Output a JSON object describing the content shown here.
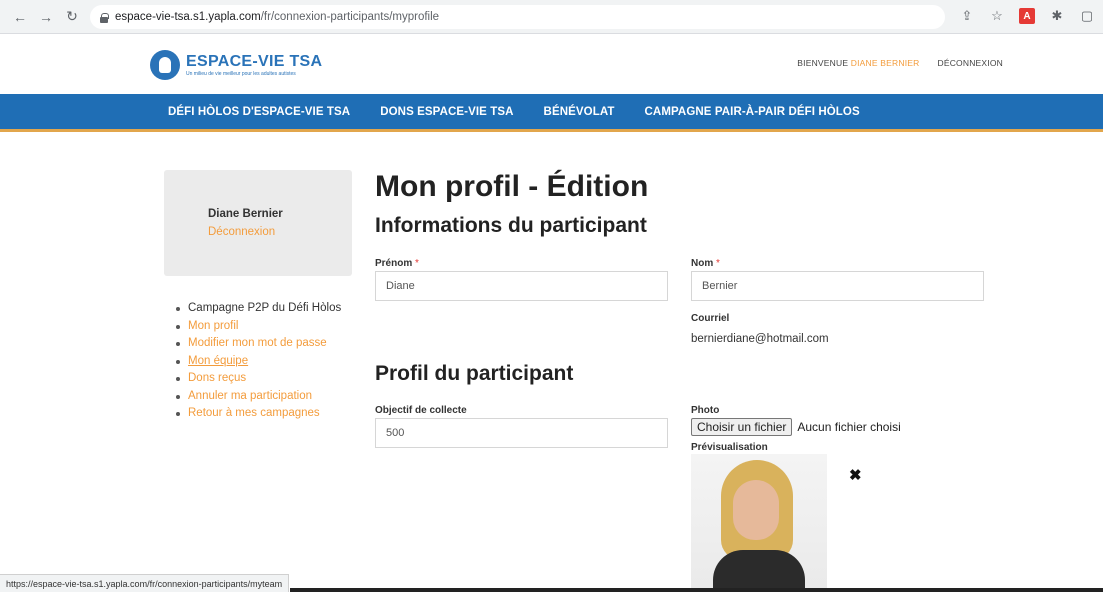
{
  "browser": {
    "url_host": "espace-vie-tsa.s1.yapla.com",
    "url_path": "/fr/connexion-participants/myprofile",
    "status_url": "https://espace-vie-tsa.s1.yapla.com/fr/connexion-participants/myteam"
  },
  "header": {
    "logo_title": "ESPACE-VIE TSA",
    "logo_tagline": "Un milieu de vie meilleur pour les adultes autistes",
    "welcome": "BIENVENUE",
    "user_name": "DIANE BERNIER",
    "logout": "DÉCONNEXION"
  },
  "nav": {
    "items": [
      {
        "label": "DÉFI HÒLOS D'ESPACE-VIE TSA"
      },
      {
        "label": "DONS ESPACE-VIE TSA"
      },
      {
        "label": "BÉNÉVOLAT"
      },
      {
        "label": "CAMPAGNE PAIR-À-PAIR DÉFI HÒLOS"
      }
    ]
  },
  "sidebar": {
    "name": "Diane Bernier",
    "logout": "Déconnexion",
    "menu": [
      {
        "label": "Campagne P2P du Défi Hòlos"
      },
      {
        "label": "Mon profil"
      },
      {
        "label": "Modifier mon mot de passe"
      },
      {
        "label": "Mon équipe"
      },
      {
        "label": "Dons reçus"
      },
      {
        "label": "Annuler ma participation"
      },
      {
        "label": "Retour à mes campagnes"
      }
    ]
  },
  "main": {
    "title": "Mon profil - Édition",
    "section1": "Informations du participant",
    "section2": "Profil du participant",
    "prenom_label": "Prénom",
    "prenom_value": "Diane",
    "nom_label": "Nom",
    "nom_value": "Bernier",
    "required_mark": "*",
    "courriel_label": "Courriel",
    "courriel_value": "bernierdiane@hotmail.com",
    "objectif_label": "Objectif de collecte",
    "objectif_value": "500",
    "photo_label": "Photo",
    "file_button": "Choisir un fichier",
    "file_status": "Aucun fichier choisi",
    "preview_label": "Prévisualisation",
    "remove_symbol": "✖"
  },
  "colors": {
    "brand_blue": "#1f6eb5",
    "accent_orange": "#f39c3c",
    "nav_underline": "#e2a64c"
  }
}
